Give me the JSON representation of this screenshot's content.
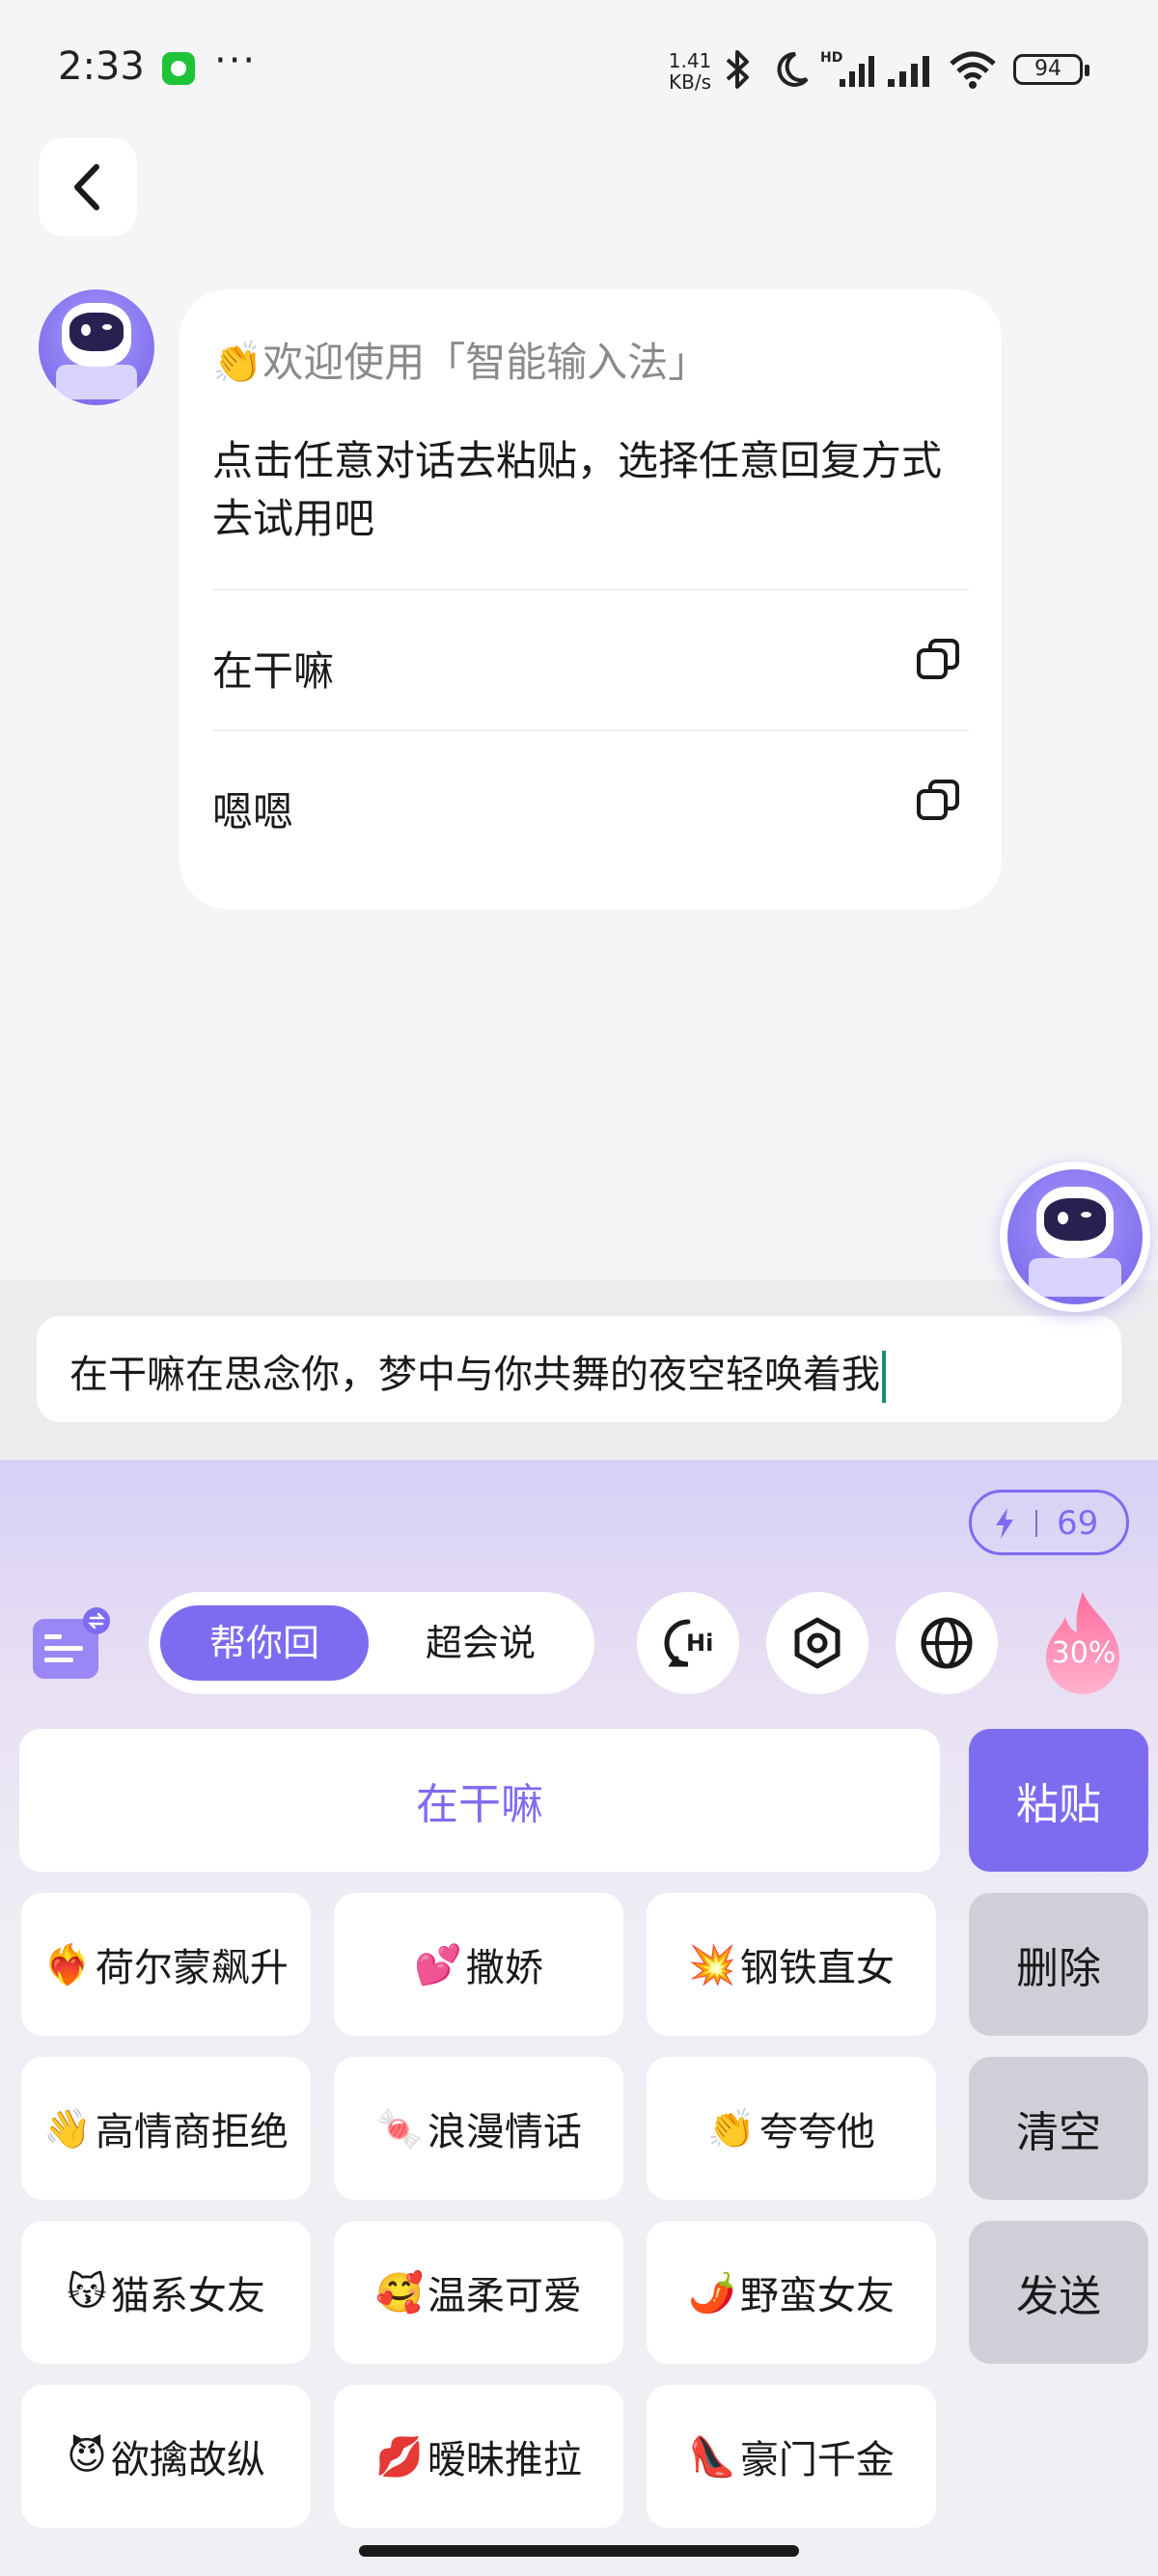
{
  "status_bar": {
    "time": "2:33",
    "net_speed_value": "1.41",
    "net_speed_unit": "KB/s",
    "battery": "94",
    "icons": [
      "wechat-icon",
      "more-icon",
      "bluetooth-icon",
      "moon-icon",
      "hd-signal-icon",
      "signal-icon",
      "wifi-icon",
      "battery-icon"
    ]
  },
  "chat": {
    "welcome_emoji": "👏",
    "welcome_text": "欢迎使用「智能输入法」",
    "instruction": "点击任意对话去粘贴，选择任意回复方式去试用吧",
    "replies": [
      {
        "text": "在干嘛"
      },
      {
        "text": "嗯嗯"
      }
    ]
  },
  "input": {
    "value": "在干嘛在思念你，梦中与你共舞的夜空轻唤着我"
  },
  "keyboard": {
    "energy_count": "69",
    "modes": {
      "active": "帮你回",
      "inactive": "超会说"
    },
    "toolbar_icons": [
      "hi-chat-icon",
      "settings-hex-icon",
      "globe-icon"
    ],
    "heat_percent": "30%",
    "suggestion": "在干嘛",
    "side_keys": {
      "paste": "粘贴",
      "delete": "删除",
      "clear": "清空",
      "send": "发送"
    },
    "styles": [
      [
        {
          "emoji": "❤️‍🔥",
          "label": "荷尔蒙飙升"
        },
        {
          "emoji": "💕",
          "label": "撒娇"
        },
        {
          "emoji": "💥",
          "label": "钢铁直女"
        }
      ],
      [
        {
          "emoji": "👋",
          "label": "高情商拒绝"
        },
        {
          "emoji": "🍬",
          "label": "浪漫情话"
        },
        {
          "emoji": "👏",
          "label": "夸夸他"
        }
      ],
      [
        {
          "emoji": "😽",
          "label": "猫系女友"
        },
        {
          "emoji": "🥰",
          "label": "温柔可爱"
        },
        {
          "emoji": "🌶️",
          "label": "野蛮女友"
        }
      ],
      [
        {
          "emoji": "😈",
          "label": "欲擒故纵"
        },
        {
          "emoji": "💋",
          "label": "暧昧推拉"
        },
        {
          "emoji": "👠",
          "label": "豪门千金"
        }
      ]
    ]
  },
  "colors": {
    "accent": "#7d6cf0",
    "background": "#f5f5f7",
    "side_key": "#cfcfd7"
  }
}
